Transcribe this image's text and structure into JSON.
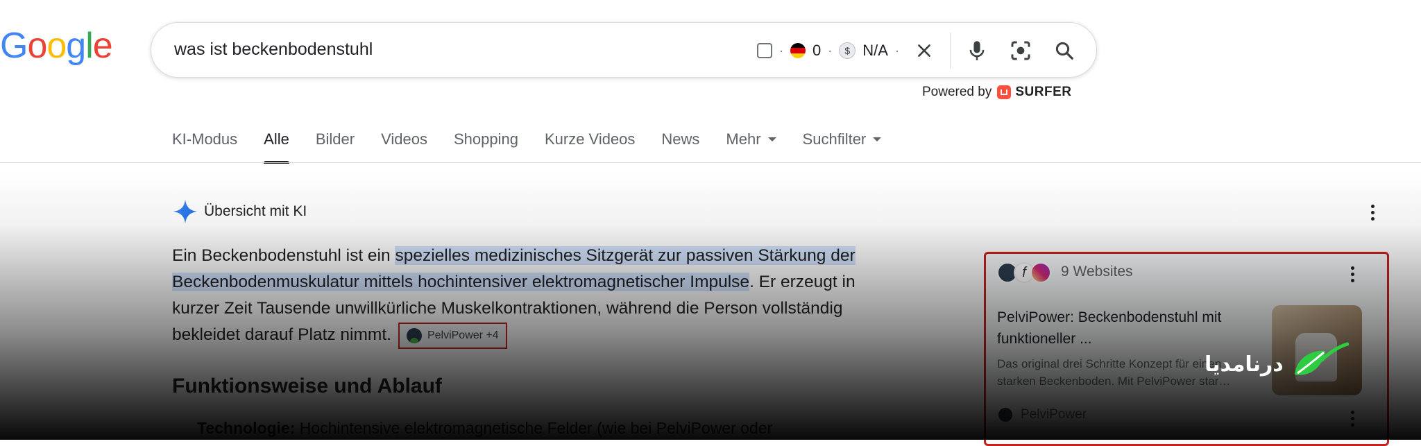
{
  "logo": {
    "text": "Google",
    "letters": [
      "G",
      "o",
      "o",
      "g",
      "l",
      "e"
    ],
    "colors": [
      "#4285F4",
      "#EA4335",
      "#FBBC05",
      "#4285F4",
      "#34A853",
      "#EA4335"
    ]
  },
  "search": {
    "query": "was ist beckenbodenstuhl",
    "ext_count": "0",
    "ext_value": "N/A",
    "icons": [
      "checkbox-icon",
      "germany-flag-icon",
      "dollar-icon",
      "close-icon",
      "microphone-icon",
      "lens-icon",
      "search-icon"
    ]
  },
  "powered": {
    "prefix": "Powered by",
    "brand": "SURFER",
    "brand_color": "#ff4f3c"
  },
  "tabs": [
    {
      "label": "KI-Modus"
    },
    {
      "label": "Alle",
      "active": true
    },
    {
      "label": "Bilder"
    },
    {
      "label": "Videos"
    },
    {
      "label": "Shopping"
    },
    {
      "label": "Kurze Videos"
    },
    {
      "label": "News"
    },
    {
      "label": "Mehr"
    },
    {
      "label": "Suchfilter"
    }
  ],
  "ai_overview": {
    "title": "Übersicht mit KI",
    "answer": {
      "part1": "Ein Beckenbodenstuhl ist ein ",
      "highlight": "spezielles medizinisches Sitzgerät zur passiven Stärkung der Beckenbodenmuskulatur mittels hochintensiver elektromagnetischer Impulse",
      "part2": ". Er erzeugt in kurzer Zeit Tausende unwillkürliche Muskelkontraktionen, während die Person vollständig bekleidet darauf Platz nimmt.",
      "chip": "PelviPower +4"
    },
    "section_heading": "Funktionsweise und Ablauf",
    "bullet_label": "Technologie:",
    "bullet_text": " Hochintensive elektromagnetische Felder (wie bei PelviPower oder"
  },
  "sources": {
    "count": "9 Websites",
    "card_title": "PelviPower: Beckenbodenstuhl mit funktioneller ...",
    "card_snippet": "Das original drei Schritte Konzept für einen starken Beckenboden. Mit PelviPower star…",
    "site": "PelviPower"
  },
  "watermark": {
    "text": "درنامدیا"
  },
  "colors": {
    "accent_red": "#c5221f",
    "highlight": "#d3e3fd",
    "ai_spark": "#4285F4"
  }
}
